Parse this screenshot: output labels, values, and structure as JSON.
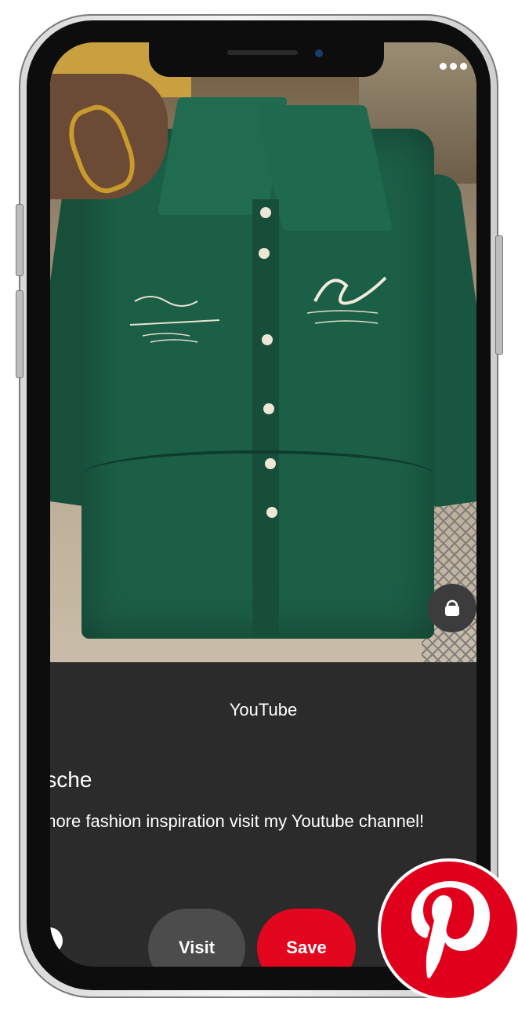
{
  "pin": {
    "source": "YouTube",
    "title": "Bosche",
    "description": "For more fashion inspiration visit my Youtube channel!"
  },
  "actions": {
    "visit_label": "Visit",
    "save_label": "Save"
  },
  "icons": {
    "more": "more-options-icon",
    "shop": "shopping-bag-icon",
    "brand": "pinterest-logo-icon"
  },
  "colors": {
    "save_button": "#e3061f",
    "visit_button": "#4c4c4c",
    "panel_background": "#2b2b2b",
    "pinterest_red": "#e0001b"
  }
}
